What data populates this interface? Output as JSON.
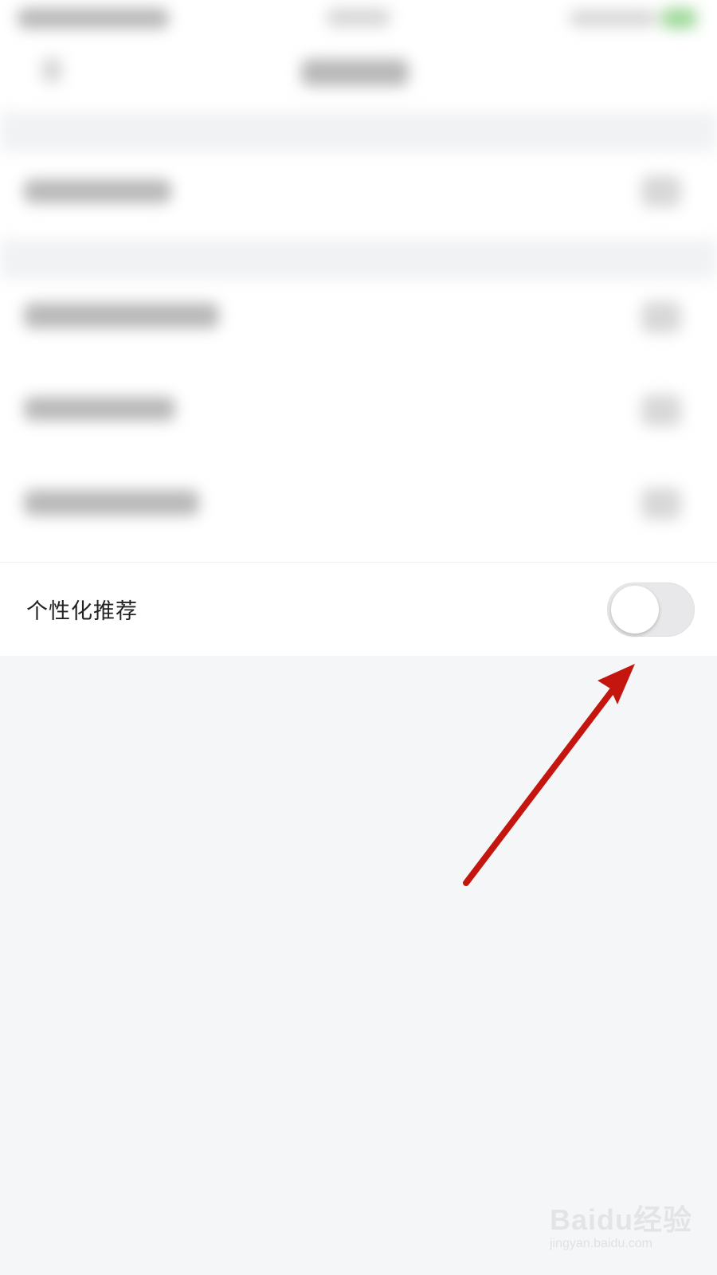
{
  "settings": {
    "personalized_recommendation": {
      "label": "个性化推荐",
      "enabled": false
    }
  },
  "annotation": {
    "arrow_color": "#c4160e"
  },
  "watermark": {
    "logo_text": "Baidu经验",
    "url_text": "jingyan.baidu.com"
  },
  "colors": {
    "background": "#f5f6f8",
    "row_background": "#ffffff",
    "toggle_off": "#e8e8ea"
  }
}
